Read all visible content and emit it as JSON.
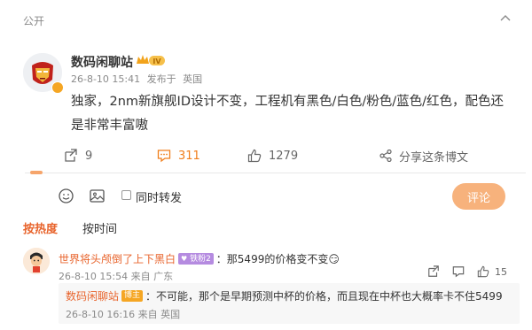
{
  "post": {
    "visibility": "公开",
    "author": "数码闲聊站",
    "level": "IV",
    "timestamp": "26-8-10 15:41",
    "source_prefix": "发布于",
    "location": "英国",
    "text": "独家，2nm新旗舰ID设计不变，工程机有黑色/白色/粉色/蓝色/红色，配色还是非常丰富嗷",
    "actions": {
      "repost_count": "9",
      "comment_count": "311",
      "like_count": "1279",
      "share_label": "分享这条博文"
    }
  },
  "comment_box": {
    "repost_label": "同时转发",
    "submit_label": "评论"
  },
  "sort": {
    "hot_label": "按热度",
    "time_label": "按时间"
  },
  "comments": [
    {
      "user": "世界将头颅倒了上下黑白",
      "badge": "铁粉2",
      "text": "：那5499的价格变不变",
      "emoji": "😏",
      "timestamp": "26-8-10 15:54",
      "source": "来自 广东",
      "like_count": "15",
      "reply": {
        "user": "数码闲聊站",
        "badge": "博主",
        "text": "：不可能，那个是早期预测中杯的价格，而且现在中杯也大概率卡不住5499",
        "timestamp": "26-8-10 16:16",
        "source": "来自 英国"
      }
    }
  ],
  "colors": {
    "accent": "#f07e1b",
    "username": "#e8642c",
    "submit_bg": "#f7b27c",
    "fan_badge": "#b58be0",
    "host_badge": "#f5a623"
  }
}
